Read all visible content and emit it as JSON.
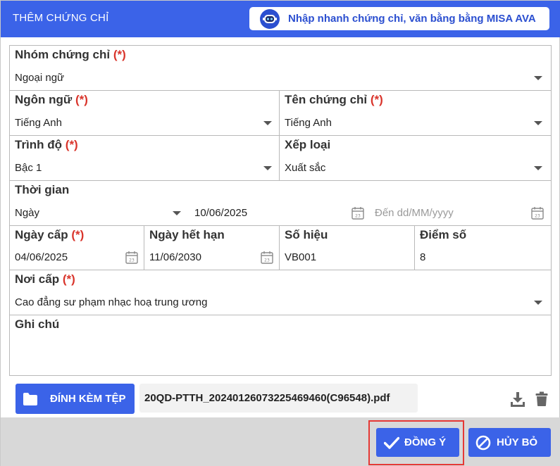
{
  "dialog": {
    "title": "THÊM CHỨNG CHỈ",
    "ava_button_label": "Nhập nhanh chứng chỉ, văn bằng bằng MISA AVA"
  },
  "form": {
    "required_mark": "(*)",
    "group": {
      "label": "Nhóm chứng chỉ",
      "value": "Ngoại ngữ"
    },
    "language": {
      "label": "Ngôn ngữ",
      "value": "Tiếng Anh"
    },
    "certificate_name": {
      "label": "Tên chứng chỉ",
      "value": "Tiếng Anh"
    },
    "level": {
      "label": "Trình độ",
      "value": "Bậc 1"
    },
    "rating": {
      "label": "Xếp loại",
      "value": "Xuất sắc"
    },
    "time": {
      "label": "Thời gian",
      "unit": "Ngày",
      "from": "10/06/2025",
      "to_placeholder": "Đến dd/MM/yyyy"
    },
    "issue_date": {
      "label": "Ngày cấp",
      "value": "04/06/2025"
    },
    "expiry_date": {
      "label": "Ngày hết hạn",
      "value": "11/06/2030"
    },
    "number": {
      "label": "Số hiệu",
      "value": "VB001"
    },
    "score": {
      "label": "Điểm số",
      "value": "8"
    },
    "issuer": {
      "label": "Nơi cấp",
      "value": "Cao đẳng sư phạm nhạc hoạ trung ương"
    },
    "note": {
      "label": "Ghi chú",
      "value": ""
    }
  },
  "attachment": {
    "button_label": "ĐÍNH KÈM TỆP",
    "file_name": "20QD-PTTH_20240126073225469460(C96548).pdf"
  },
  "footer": {
    "ok_label": "ĐỒNG Ý",
    "cancel_label": "HỦY BỎ"
  },
  "colors": {
    "primary": "#3b63e8",
    "required": "#d9342b",
    "focus_ring": "#e53935"
  },
  "icons": [
    "robot-icon",
    "chevron-down-icon",
    "calendar-icon",
    "folder-icon",
    "download-icon",
    "trash-icon",
    "check-icon",
    "ban-icon"
  ]
}
